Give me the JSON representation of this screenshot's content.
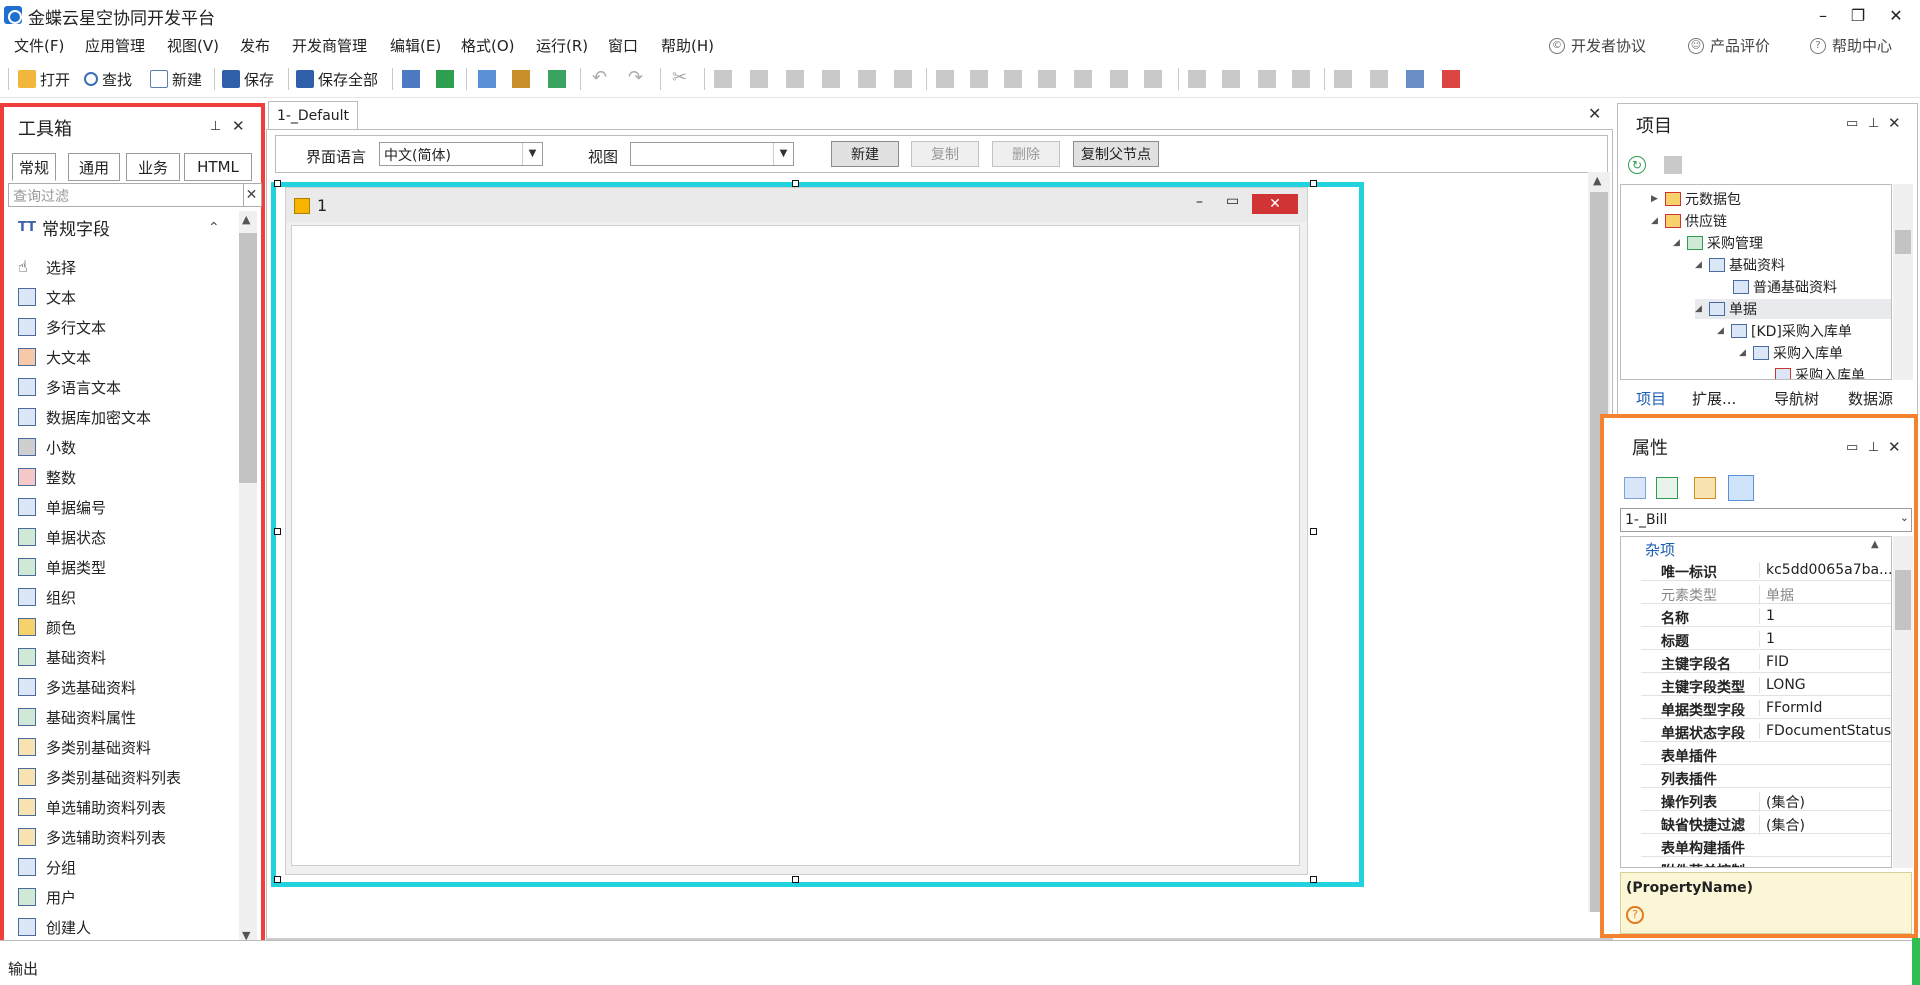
{
  "window": {
    "title": "金蝶云星空协同开发平台",
    "minimize": "–",
    "restore": "❐",
    "close": "✕"
  },
  "menu": {
    "items": [
      "文件(F)",
      "应用管理",
      "视图(V)",
      "发布",
      "开发商管理",
      "编辑(E)",
      "格式(O)",
      "运行(R)",
      "窗口",
      "帮助(H)"
    ],
    "right": [
      "开发者协议",
      "产品评价",
      "帮助中心"
    ]
  },
  "toolbar": {
    "open": "打开",
    "find": "查找",
    "new": "新建",
    "save": "保存",
    "save_all": "保存全部"
  },
  "toolbox": {
    "title": "工具箱",
    "tabs": [
      "常规",
      "通用",
      "业务",
      "HTML"
    ],
    "search_placeholder": "查询过滤",
    "group": "常规字段",
    "items": [
      "选择",
      "文本",
      "多行文本",
      "大文本",
      "多语言文本",
      "数据库加密文本",
      "小数",
      "整数",
      "单据编号",
      "单据状态",
      "单据类型",
      "组织",
      "颜色",
      "基础资料",
      "多选基础资料",
      "基础资料属性",
      "多类别基础资料",
      "多类别基础资料列表",
      "单选辅助资料列表",
      "多选辅助资料列表",
      "分组",
      "用户",
      "创建人"
    ]
  },
  "document": {
    "tab": "1-_Default",
    "lang_label": "界面语言",
    "lang_value": "中文(简体)",
    "view_label": "视图",
    "view_value": "",
    "buttons": {
      "new": "新建",
      "copy": "复制",
      "delete": "删除",
      "copy_parent": "复制父节点"
    },
    "form_title": "1"
  },
  "project": {
    "title": "项目",
    "tree": [
      {
        "label": "元数据包",
        "level": 0
      },
      {
        "label": "供应链",
        "level": 0
      },
      {
        "label": "采购管理",
        "level": 1
      },
      {
        "label": "基础资料",
        "level": 2
      },
      {
        "label": "普通基础资料",
        "level": 3
      },
      {
        "label": "单据",
        "level": 2
      },
      {
        "label": "[KD]采购入库单",
        "level": 3
      },
      {
        "label": "采购入库单",
        "level": 4
      },
      {
        "label": "采购入库单",
        "level": 5
      }
    ],
    "tabs": [
      "项目",
      "扩展...",
      "导航树",
      "数据源"
    ]
  },
  "properties": {
    "title": "属性",
    "object": "1-_Bill",
    "category": "杂项",
    "rows": [
      {
        "name": "唯一标识",
        "value": "kc5dd0065a7ba..."
      },
      {
        "name": "元素类型",
        "value": "单据"
      },
      {
        "name": "名称",
        "value": "1"
      },
      {
        "name": "标题",
        "value": "1"
      },
      {
        "name": "主键字段名",
        "value": "FID"
      },
      {
        "name": "主键字段类型",
        "value": "LONG"
      },
      {
        "name": "单据类型字段",
        "value": "FFormId"
      },
      {
        "name": "单据状态字段",
        "value": "FDocumentStatus"
      },
      {
        "name": "表单插件",
        "value": ""
      },
      {
        "name": "列表插件",
        "value": ""
      },
      {
        "name": "操作列表",
        "value": "(集合)"
      },
      {
        "name": "缺省快捷过滤",
        "value": "(集合)"
      },
      {
        "name": "表单构建插件",
        "value": ""
      },
      {
        "name": "附件获单控制",
        "value": ""
      }
    ],
    "description_title": "(PropertyName)"
  },
  "output": {
    "label": "输出"
  }
}
